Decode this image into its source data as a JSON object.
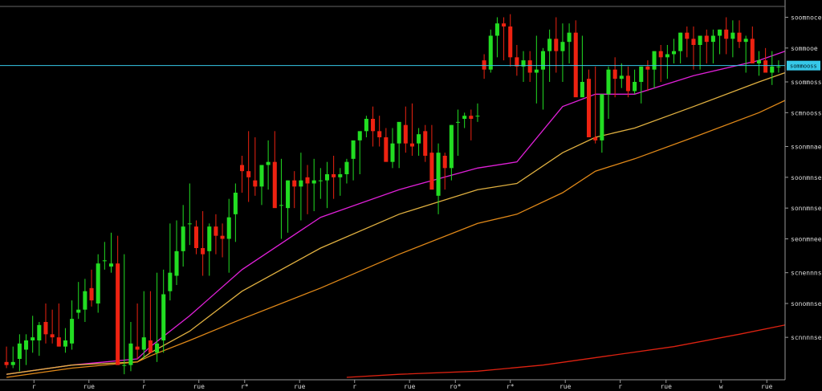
{
  "chart_data": {
    "type": "candlestick",
    "title": "",
    "xlabel": "",
    "ylabel": "",
    "grid": false,
    "legend": "none",
    "ylim": [
      0,
      120
    ],
    "y_tick_labels": [
      "soomnoce",
      "sommooe",
      "ssommoss",
      "scmnooss",
      "ssonmnae",
      "soonmnse",
      "sonnmnse",
      "seonmnee",
      "scnennnse",
      "sonomnse",
      "scnnnnse"
    ],
    "y_tick_values": [
      117,
      107,
      96,
      86,
      75,
      65,
      55,
      45,
      34,
      24,
      13
    ],
    "current_price_label": "sommooss",
    "current_price_value": 101.3,
    "x_tick_labels": [
      "r",
      "rue",
      "r",
      "rue",
      "r*",
      "rue",
      "r",
      "rue",
      "ro*",
      "r*",
      "rue",
      "r",
      "rue",
      "w",
      "rue"
    ],
    "x_tick_positions": [
      3,
      9,
      15,
      21,
      26,
      32,
      38,
      44,
      49,
      55,
      61,
      67,
      72,
      78,
      83
    ],
    "colors": {
      "background": "#000000",
      "up": "#22dd22",
      "down": "#ee2211",
      "ma_magenta": "#e020d8",
      "ma_yellow": "#e0b040",
      "ma_orange": "#e08818",
      "ma_red": "#dd2211",
      "price_line": "#36c8e8",
      "axis": "#999999"
    },
    "candles": {
      "o": [
        5,
        4,
        6,
        9,
        12,
        12,
        18,
        14,
        13,
        10,
        11,
        21,
        22,
        29,
        24,
        38,
        36,
        37,
        4,
        4,
        10,
        9,
        12,
        8,
        12,
        28,
        33,
        41,
        50,
        49,
        42,
        41,
        49,
        46,
        45,
        53,
        69,
        67,
        64,
        62,
        69,
        70,
        56,
        55,
        64,
        62,
        65,
        63,
        64,
        64,
        66,
        65,
        66,
        71,
        77,
        80,
        84,
        80,
        78,
        70,
        76,
        82,
        76,
        76,
        80,
        73,
        59,
        72,
        68,
        83,
        84,
        85,
        85,
        103,
        100,
        111,
        115,
        114,
        104,
        101,
        103,
        99,
        100,
        106,
        110,
        106,
        109,
        112,
        91,
        97,
        78,
        77,
        92,
        100,
        97,
        98,
        93,
        96,
        101,
        100,
        106,
        104,
        105,
        106,
        112,
        110,
        108,
        111,
        109,
        111,
        113,
        110,
        112,
        109,
        110,
        102,
        103,
        99,
        101
      ],
      "h": [
        10,
        10,
        14,
        14,
        20,
        18,
        24,
        22,
        24,
        16,
        25,
        31,
        32,
        35,
        40,
        44,
        47,
        46,
        40,
        18,
        24,
        28,
        28,
        34,
        35,
        50,
        51,
        56,
        63,
        51,
        54,
        50,
        53,
        50,
        58,
        63,
        72,
        80,
        78,
        68,
        77,
        80,
        71,
        64,
        67,
        73,
        69,
        71,
        68,
        70,
        72,
        68,
        71,
        74,
        78,
        85,
        88,
        85,
        81,
        81,
        80,
        88,
        89,
        81,
        82,
        82,
        76,
        73,
        82,
        87,
        86,
        87,
        89,
        105,
        113,
        117,
        117,
        118,
        108,
        106,
        106,
        111,
        107,
        113,
        117,
        115,
        115,
        116,
        111,
        100,
        101,
        90,
        101,
        104,
        102,
        101,
        100,
        101,
        103,
        104,
        108,
        108,
        110,
        112,
        114,
        114,
        110,
        113,
        113,
        113,
        117,
        116,
        116,
        111,
        114,
        106,
        107,
        106,
        103
      ],
      "l": [
        3,
        3,
        2,
        4,
        8,
        7,
        11,
        11,
        10,
        8,
        9,
        19,
        18,
        23,
        21,
        35,
        34,
        36,
        1,
        2,
        6,
        6,
        9,
        5,
        8,
        25,
        30,
        36,
        43,
        40,
        33,
        33,
        40,
        39,
        34,
        44,
        60,
        57,
        59,
        56,
        61,
        62,
        45,
        47,
        55,
        51,
        53,
        54,
        58,
        55,
        58,
        59,
        63,
        64,
        66,
        78,
        75,
        75,
        73,
        68,
        68,
        73,
        72,
        72,
        70,
        66,
        53,
        61,
        64,
        72,
        81,
        77,
        83,
        97,
        99,
        104,
        103,
        101,
        98,
        96,
        96,
        89,
        87,
        96,
        99,
        96,
        102,
        104,
        92,
        85,
        76,
        73,
        84,
        91,
        94,
        91,
        92,
        89,
        93,
        94,
        96,
        97,
        102,
        102,
        104,
        100,
        100,
        102,
        102,
        105,
        105,
        104,
        107,
        99,
        104,
        98,
        99,
        95,
        99
      ],
      "c": [
        4,
        5,
        11,
        12,
        13,
        17,
        14,
        13,
        10,
        12,
        19,
        22,
        28,
        25,
        37,
        38,
        37,
        4,
        4,
        11,
        9,
        13,
        8,
        11,
        27,
        34,
        41,
        49,
        50,
        42,
        40,
        49,
        46,
        45,
        52,
        60,
        67,
        65,
        62,
        69,
        70,
        55,
        56,
        64,
        62,
        64,
        63,
        64,
        64,
        66,
        65,
        66,
        70,
        77,
        80,
        84,
        80,
        78,
        70,
        76,
        83,
        76,
        75,
        79,
        72,
        61,
        73,
        68,
        82,
        83,
        85,
        84,
        85,
        100,
        111,
        115,
        114,
        104,
        101,
        103,
        99,
        100,
        106,
        110,
        106,
        109,
        112,
        91,
        96,
        78,
        77,
        92,
        100,
        97,
        98,
        93,
        96,
        101,
        100,
        106,
        104,
        105,
        106,
        112,
        110,
        108,
        111,
        109,
        111,
        113,
        110,
        112,
        109,
        110,
        102,
        103,
        99,
        101,
        101
      ]
    },
    "series": [
      {
        "name": "",
        "type": "line",
        "x": [
          0,
          10,
          20,
          22,
          28,
          36,
          48,
          60,
          72,
          78,
          85,
          90,
          96,
          105,
          115,
          119
        ],
        "y": [
          1,
          4,
          6,
          10,
          20,
          35,
          52,
          61,
          68,
          70,
          88,
          92,
          92,
          98,
          103,
          106
        ]
      },
      {
        "name": "",
        "type": "line",
        "x": [
          0,
          10,
          20,
          22,
          28,
          36,
          48,
          60,
          72,
          78,
          85,
          90,
          96,
          105,
          115,
          119
        ],
        "y": [
          1,
          4,
          5,
          8,
          15,
          28,
          42,
          53,
          61,
          63,
          73,
          78,
          81,
          88,
          96,
          99
        ]
      },
      {
        "name": "",
        "type": "line",
        "x": [
          0,
          10,
          20,
          22,
          28,
          36,
          48,
          60,
          72,
          78,
          85,
          90,
          96,
          105,
          115,
          119
        ],
        "y": [
          0,
          3,
          5,
          7,
          12,
          19,
          29,
          40,
          50,
          53,
          60,
          67,
          71,
          78,
          86,
          90
        ]
      },
      {
        "name": "",
        "type": "line",
        "x": [
          52,
          60,
          72,
          82,
          92,
          102,
          112,
          119
        ],
        "y": [
          0,
          1,
          2,
          4,
          7,
          10,
          14,
          17
        ]
      }
    ]
  }
}
